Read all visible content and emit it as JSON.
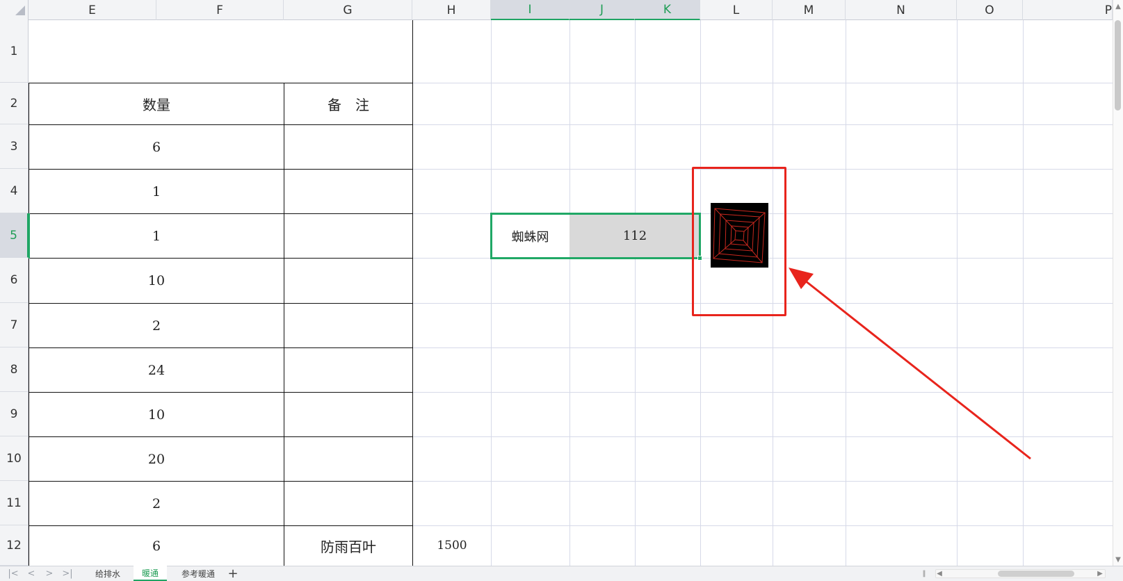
{
  "columns": [
    "E",
    "F",
    "G",
    "H",
    "I",
    "J",
    "K",
    "L",
    "M",
    "N",
    "O",
    "P"
  ],
  "rows": [
    "1",
    "2",
    "3",
    "4",
    "5",
    "6",
    "7",
    "8",
    "9",
    "10",
    "11",
    "12"
  ],
  "table": {
    "header_quantity": "数量",
    "header_remark": "备　注",
    "quantities": [
      "6",
      "1",
      "1",
      "10",
      "2",
      "24",
      "10",
      "20",
      "2",
      "6"
    ],
    "remark_row12": "防雨百叶"
  },
  "cell_h12": "1500",
  "selection": {
    "label": "蜘蛛网",
    "value": "112"
  },
  "colors": {
    "selection": "#20a866",
    "annotation": "#e8241c",
    "table_border": "#111111",
    "gridline": "#d6d9e8"
  },
  "sheet_tabs": [
    "给排水",
    "暖通",
    "参考暖通"
  ],
  "active_sheet": "暖通",
  "icons": {
    "first": "first-sheet-icon",
    "prev": "prev-sheet-icon",
    "next": "next-sheet-icon",
    "last": "last-sheet-icon",
    "add": "add-sheet-icon"
  },
  "nav_glyphs": {
    "first": "|<",
    "prev": "<",
    "next": ">",
    "last": ">|",
    "add": "+"
  }
}
